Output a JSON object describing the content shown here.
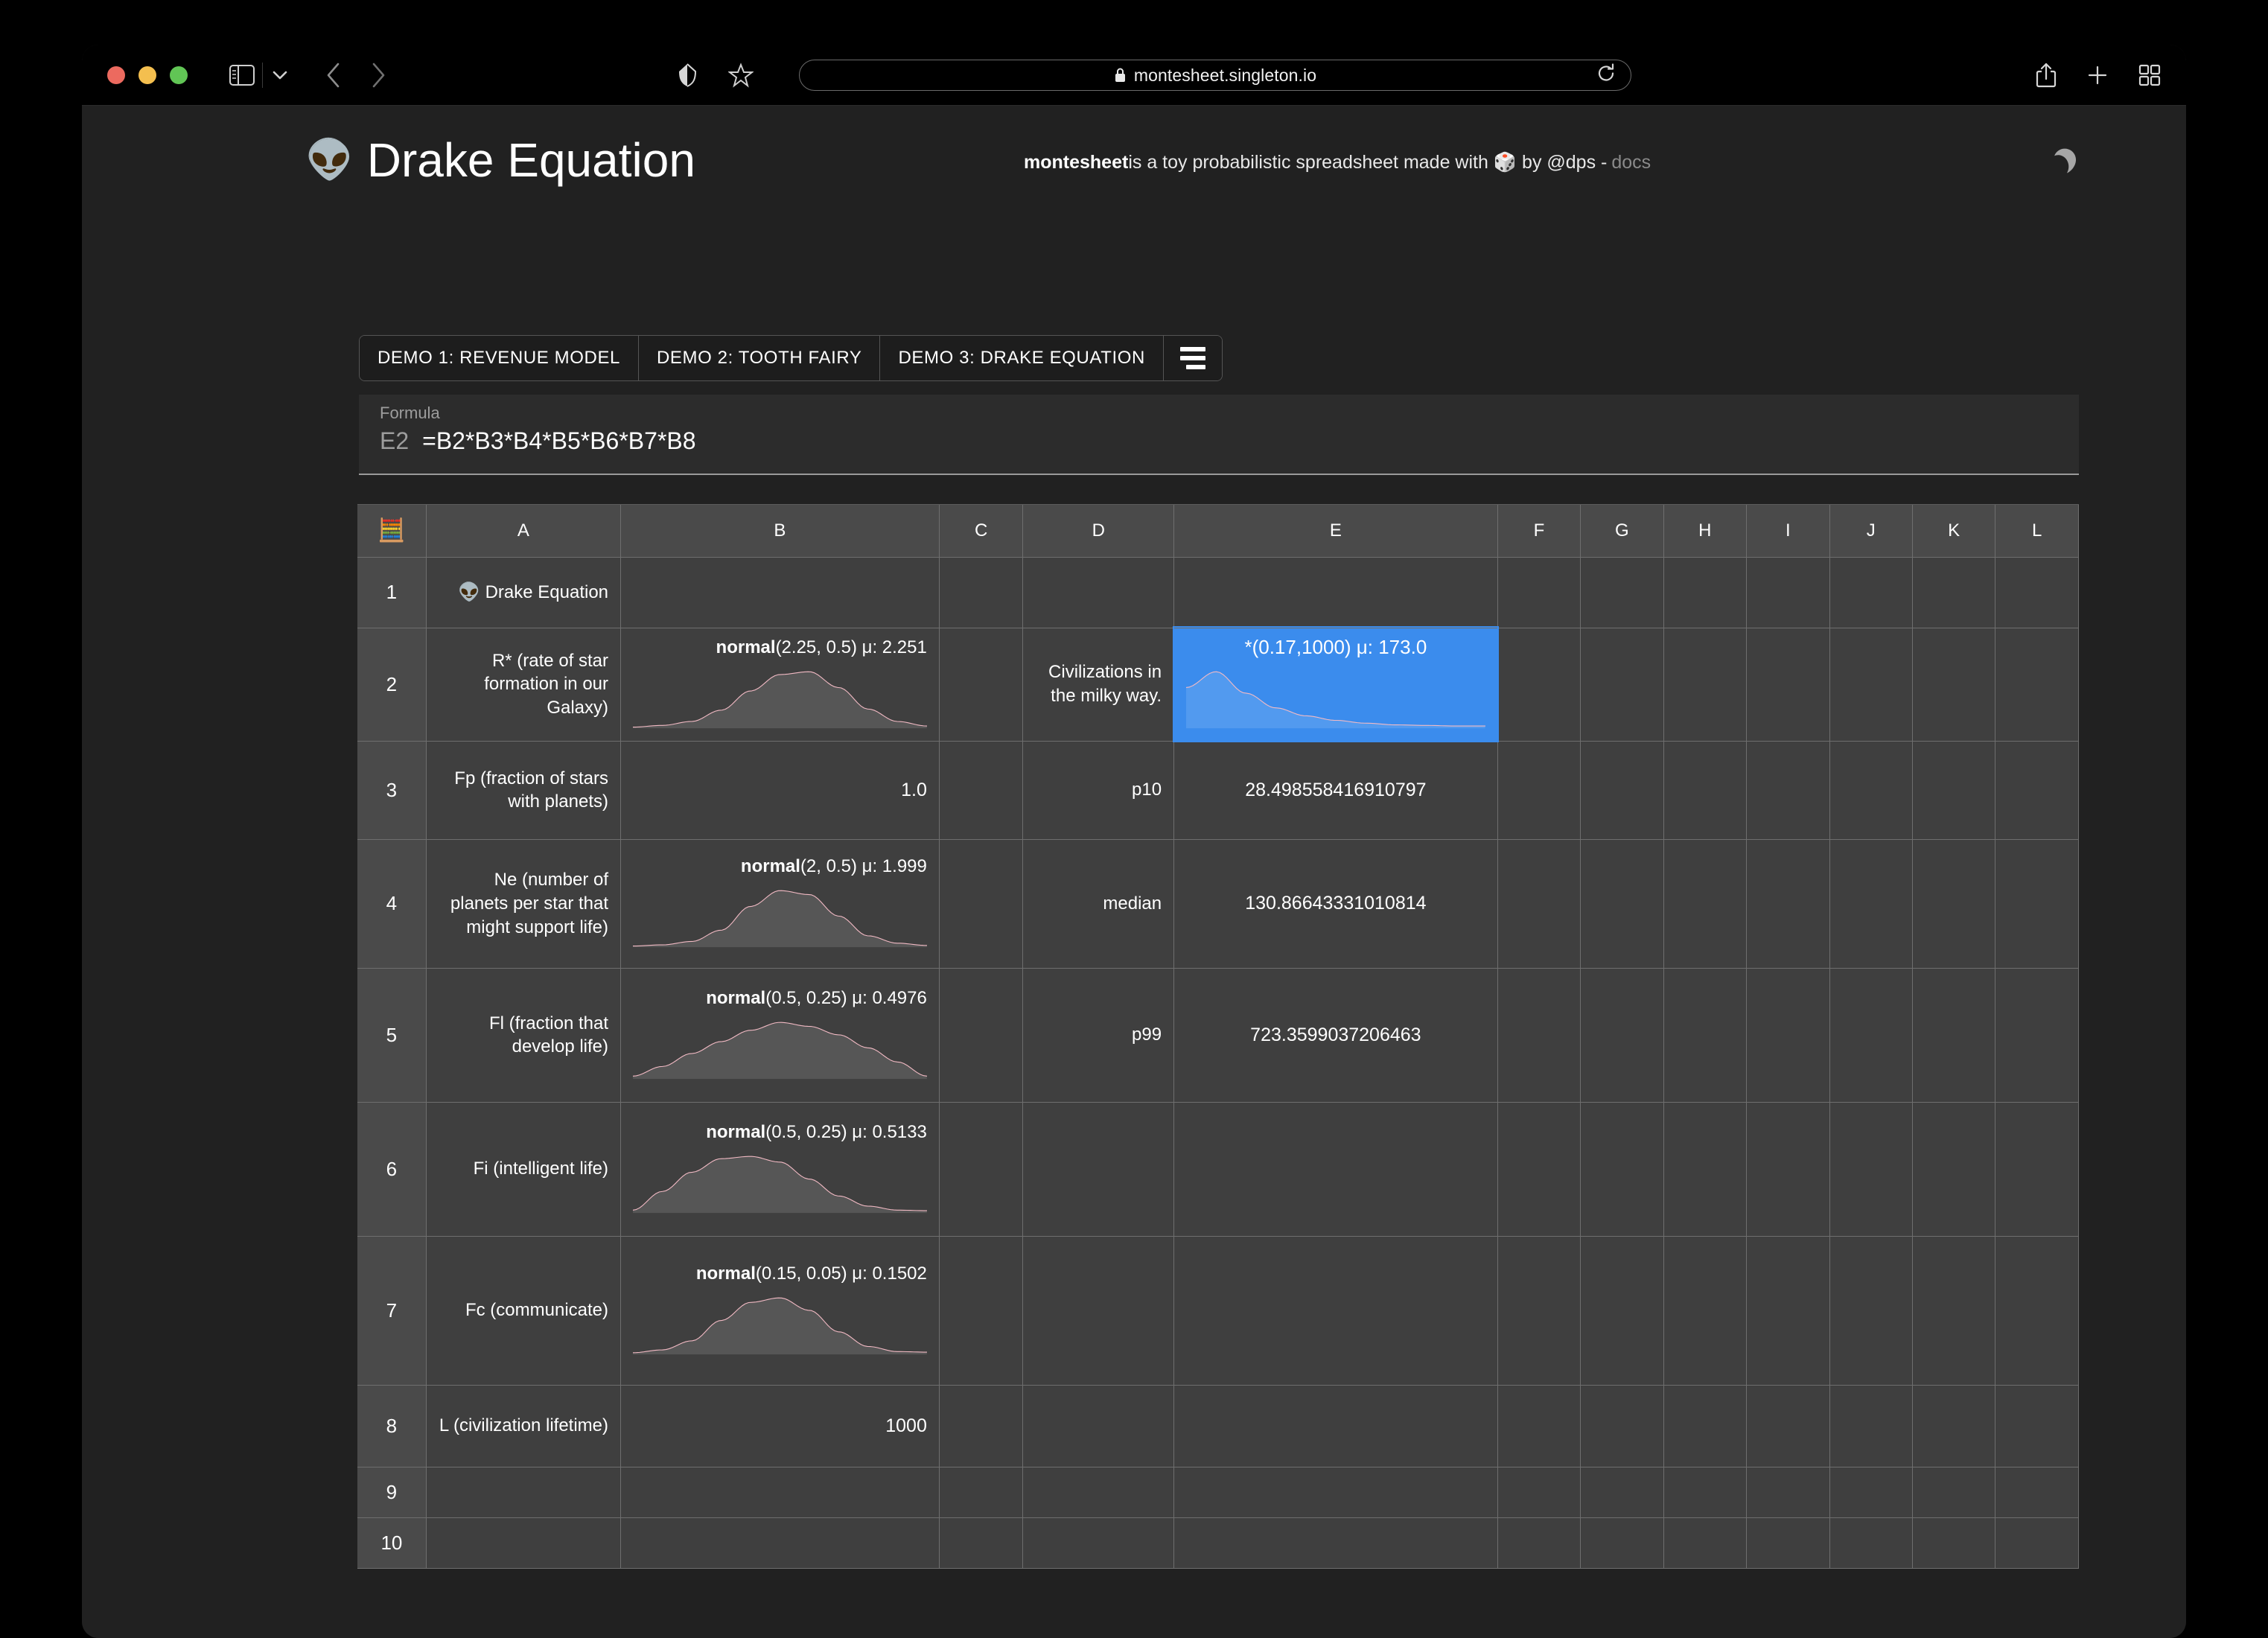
{
  "browser": {
    "url": "montesheet.singleton.io",
    "lock_icon": "lock-icon",
    "reload_icon": "reload-icon",
    "share_icon": "share-icon",
    "newtab_icon": "plus-icon",
    "taboverview_icon": "tab-overview-icon",
    "shield_icon": "shield-icon",
    "bookmark_icon": "star-icon",
    "sidebar_icon": "sidebar-icon",
    "back_icon": "chevron-left-icon",
    "forward_icon": "chevron-right-icon",
    "dropdown_icon": "chevron-down-icon"
  },
  "header": {
    "alien_icon": "alien-emoji",
    "title": "Drake Equation",
    "tagline_brand": "montesheet",
    "tagline_mid": " is a toy probabilistic spreadsheet made with ",
    "dice_icon": "game-die-emoji",
    "tagline_by": " by @dps - ",
    "docs_label": "docs",
    "theme_toggle_icon": "moon-icon"
  },
  "tabs": [
    {
      "label": "DEMO 1: REVENUE MODEL",
      "active": false
    },
    {
      "label": "DEMO 2: TOOTH FAIRY",
      "active": false
    },
    {
      "label": "DEMO 3: DRAKE EQUATION",
      "active": true
    }
  ],
  "tabs_menu_icon": "align-list-icon",
  "formula": {
    "label": "Formula",
    "cell_ref": "E2",
    "value": "=B2*B3*B4*B5*B6*B7*B8"
  },
  "sheet": {
    "corner_icon": "abacus-emoji",
    "columns": [
      "A",
      "B",
      "C",
      "D",
      "E",
      "F",
      "G",
      "H",
      "I",
      "J",
      "K",
      "L"
    ],
    "rows": [
      "1",
      "2",
      "3",
      "4",
      "5",
      "6",
      "7",
      "8",
      "9",
      "10"
    ],
    "selected_cell": "E2",
    "cells": {
      "A1": "👽 Drake Equation",
      "A2": "R* (rate of star formation in our Galaxy)",
      "A3": "Fp (fraction of stars with planets)",
      "A4": "Ne (number of planets per star that might support life)",
      "A5": "Fl (fraction that develop life)",
      "A6": "Fi (intelligent life)",
      "A7": "Fc (communicate)",
      "A8": "L (civilization lifetime)",
      "B2_dist": "normal",
      "B2_args": "(2.25, 0.5) μ: 2.251",
      "B3": "1.0",
      "B4_dist": "normal",
      "B4_args": "(2, 0.5) μ: 1.999",
      "B5_dist": "normal",
      "B5_args": "(0.5, 0.25) μ: 0.4976",
      "B6_dist": "normal",
      "B6_args": "(0.5, 0.25) μ: 0.5133",
      "B7_dist": "normal",
      "B7_args": "(0.15, 0.05) μ: 0.1502",
      "B8": "1000",
      "D2": "Civilizations in the milky way.",
      "D3": "p10",
      "D4": "median",
      "D5": "p99",
      "E2_label": "*(0.17,1000) μ: 173.0",
      "E3": "28.498558416910797",
      "E4": "130.86643331010814",
      "E5": "723.3599037206463"
    }
  },
  "chart_data": [
    {
      "type": "area",
      "cell": "B2",
      "title": "normal(2.25, 0.5) μ: 2.251",
      "distribution": "normal",
      "params": {
        "mean": 2.25,
        "sd": 0.5
      },
      "mu": 2.251,
      "x": [
        0,
        0.1,
        0.2,
        0.3,
        0.4,
        0.5,
        0.6,
        0.7,
        0.8,
        0.9,
        1.0
      ],
      "values": [
        0.02,
        0.05,
        0.12,
        0.32,
        0.66,
        0.95,
        1.0,
        0.72,
        0.34,
        0.12,
        0.04
      ],
      "xlabel": "",
      "ylabel": "",
      "grid": false
    },
    {
      "type": "area",
      "cell": "B4",
      "title": "normal(2, 0.5) μ: 1.999",
      "distribution": "normal",
      "params": {
        "mean": 2,
        "sd": 0.5
      },
      "mu": 1.999,
      "x": [
        0,
        0.1,
        0.2,
        0.3,
        0.4,
        0.5,
        0.6,
        0.7,
        0.8,
        0.9,
        1.0
      ],
      "values": [
        0.02,
        0.04,
        0.1,
        0.3,
        0.72,
        1.0,
        0.93,
        0.55,
        0.2,
        0.07,
        0.03
      ],
      "xlabel": "",
      "ylabel": "",
      "grid": false
    },
    {
      "type": "area",
      "cell": "B5",
      "title": "normal(0.5, 0.25) μ: 0.4976",
      "distribution": "normal",
      "params": {
        "mean": 0.5,
        "sd": 0.25
      },
      "mu": 0.4976,
      "x": [
        0,
        0.1,
        0.2,
        0.3,
        0.4,
        0.5,
        0.6,
        0.7,
        0.8,
        0.9,
        1.0
      ],
      "values": [
        0.05,
        0.22,
        0.45,
        0.66,
        0.86,
        1.0,
        0.93,
        0.78,
        0.55,
        0.3,
        0.05
      ],
      "xlabel": "",
      "ylabel": "",
      "grid": false
    },
    {
      "type": "area",
      "cell": "B6",
      "title": "normal(0.5, 0.25) μ: 0.5133",
      "distribution": "normal",
      "params": {
        "mean": 0.5,
        "sd": 0.25
      },
      "mu": 0.5133,
      "x": [
        0,
        0.1,
        0.2,
        0.3,
        0.4,
        0.5,
        0.6,
        0.7,
        0.8,
        0.9,
        1.0
      ],
      "values": [
        0.05,
        0.38,
        0.72,
        0.96,
        1.0,
        0.9,
        0.6,
        0.3,
        0.12,
        0.05,
        0.04
      ],
      "xlabel": "",
      "ylabel": "",
      "grid": false
    },
    {
      "type": "area",
      "cell": "B7",
      "title": "normal(0.15, 0.05) μ: 0.1502",
      "distribution": "normal",
      "params": {
        "mean": 0.15,
        "sd": 0.05
      },
      "mu": 0.1502,
      "x": [
        0,
        0.1,
        0.2,
        0.3,
        0.4,
        0.5,
        0.6,
        0.7,
        0.8,
        0.9,
        1.0
      ],
      "values": [
        0.03,
        0.08,
        0.24,
        0.6,
        0.92,
        1.0,
        0.78,
        0.4,
        0.14,
        0.05,
        0.04
      ],
      "xlabel": "",
      "ylabel": "",
      "grid": false
    },
    {
      "type": "area",
      "cell": "E2",
      "title": "*(0.17,1000) μ: 173.0",
      "distribution": "product",
      "params": {
        "min": 0.17,
        "max": 1000
      },
      "mu": 173.0,
      "x": [
        0,
        0.1,
        0.2,
        0.3,
        0.4,
        0.5,
        0.6,
        0.7,
        0.8,
        0.9,
        1.0
      ],
      "values": [
        0.72,
        1.0,
        0.62,
        0.36,
        0.22,
        0.14,
        0.09,
        0.06,
        0.05,
        0.04,
        0.04
      ],
      "xlabel": "",
      "ylabel": "",
      "grid": false
    }
  ]
}
